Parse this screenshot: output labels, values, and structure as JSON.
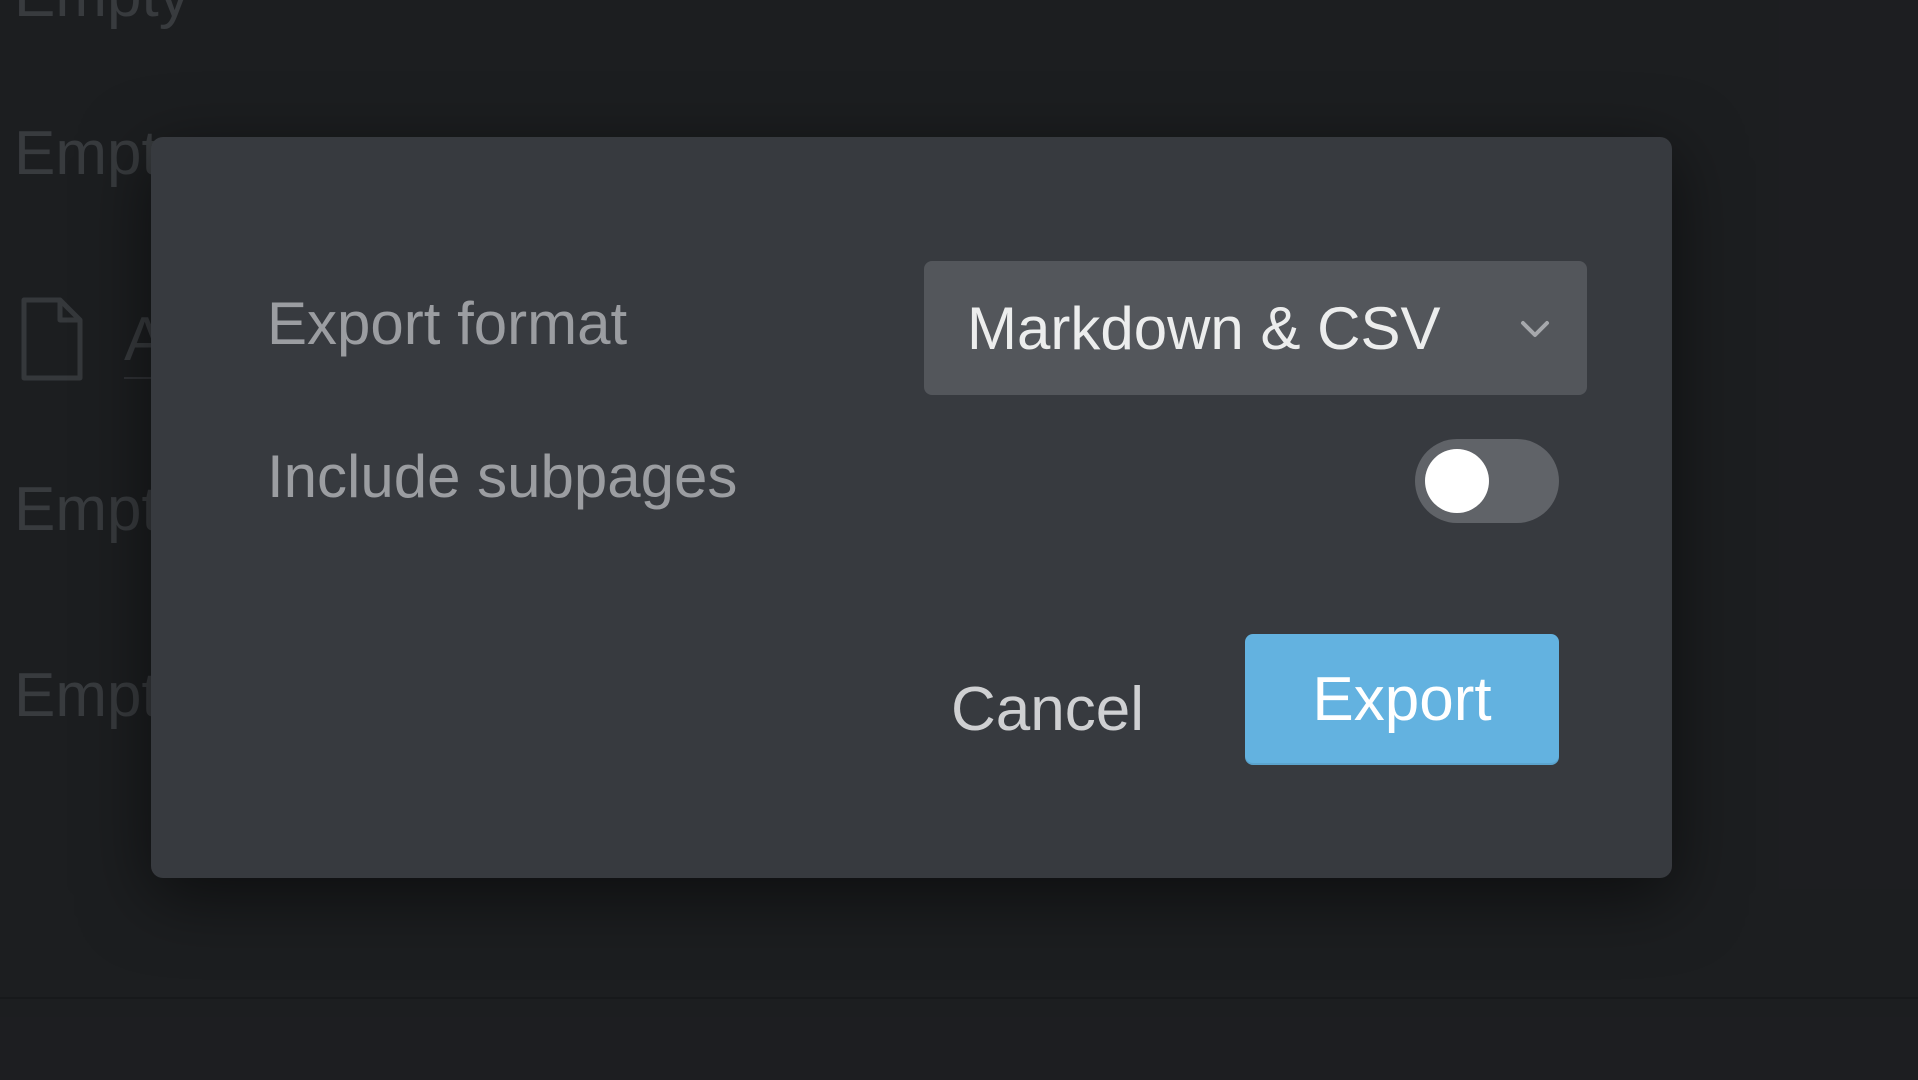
{
  "background": {
    "rows": [
      "Empty",
      "Empty",
      "Empty",
      "Empty"
    ],
    "page_title": "A",
    "page_icon": "document-icon"
  },
  "dialog": {
    "export_format_label": "Export format",
    "export_format_value": "Markdown & CSV",
    "export_format_icon": "chevron-down-icon",
    "include_subpages_label": "Include subpages",
    "include_subpages_on": false,
    "cancel_label": "Cancel",
    "export_label": "Export"
  },
  "colors": {
    "accent": "#63b2e0",
    "dialog_bg": "#373a3f",
    "select_bg": "#53565b",
    "toggle_off": "#606368"
  }
}
